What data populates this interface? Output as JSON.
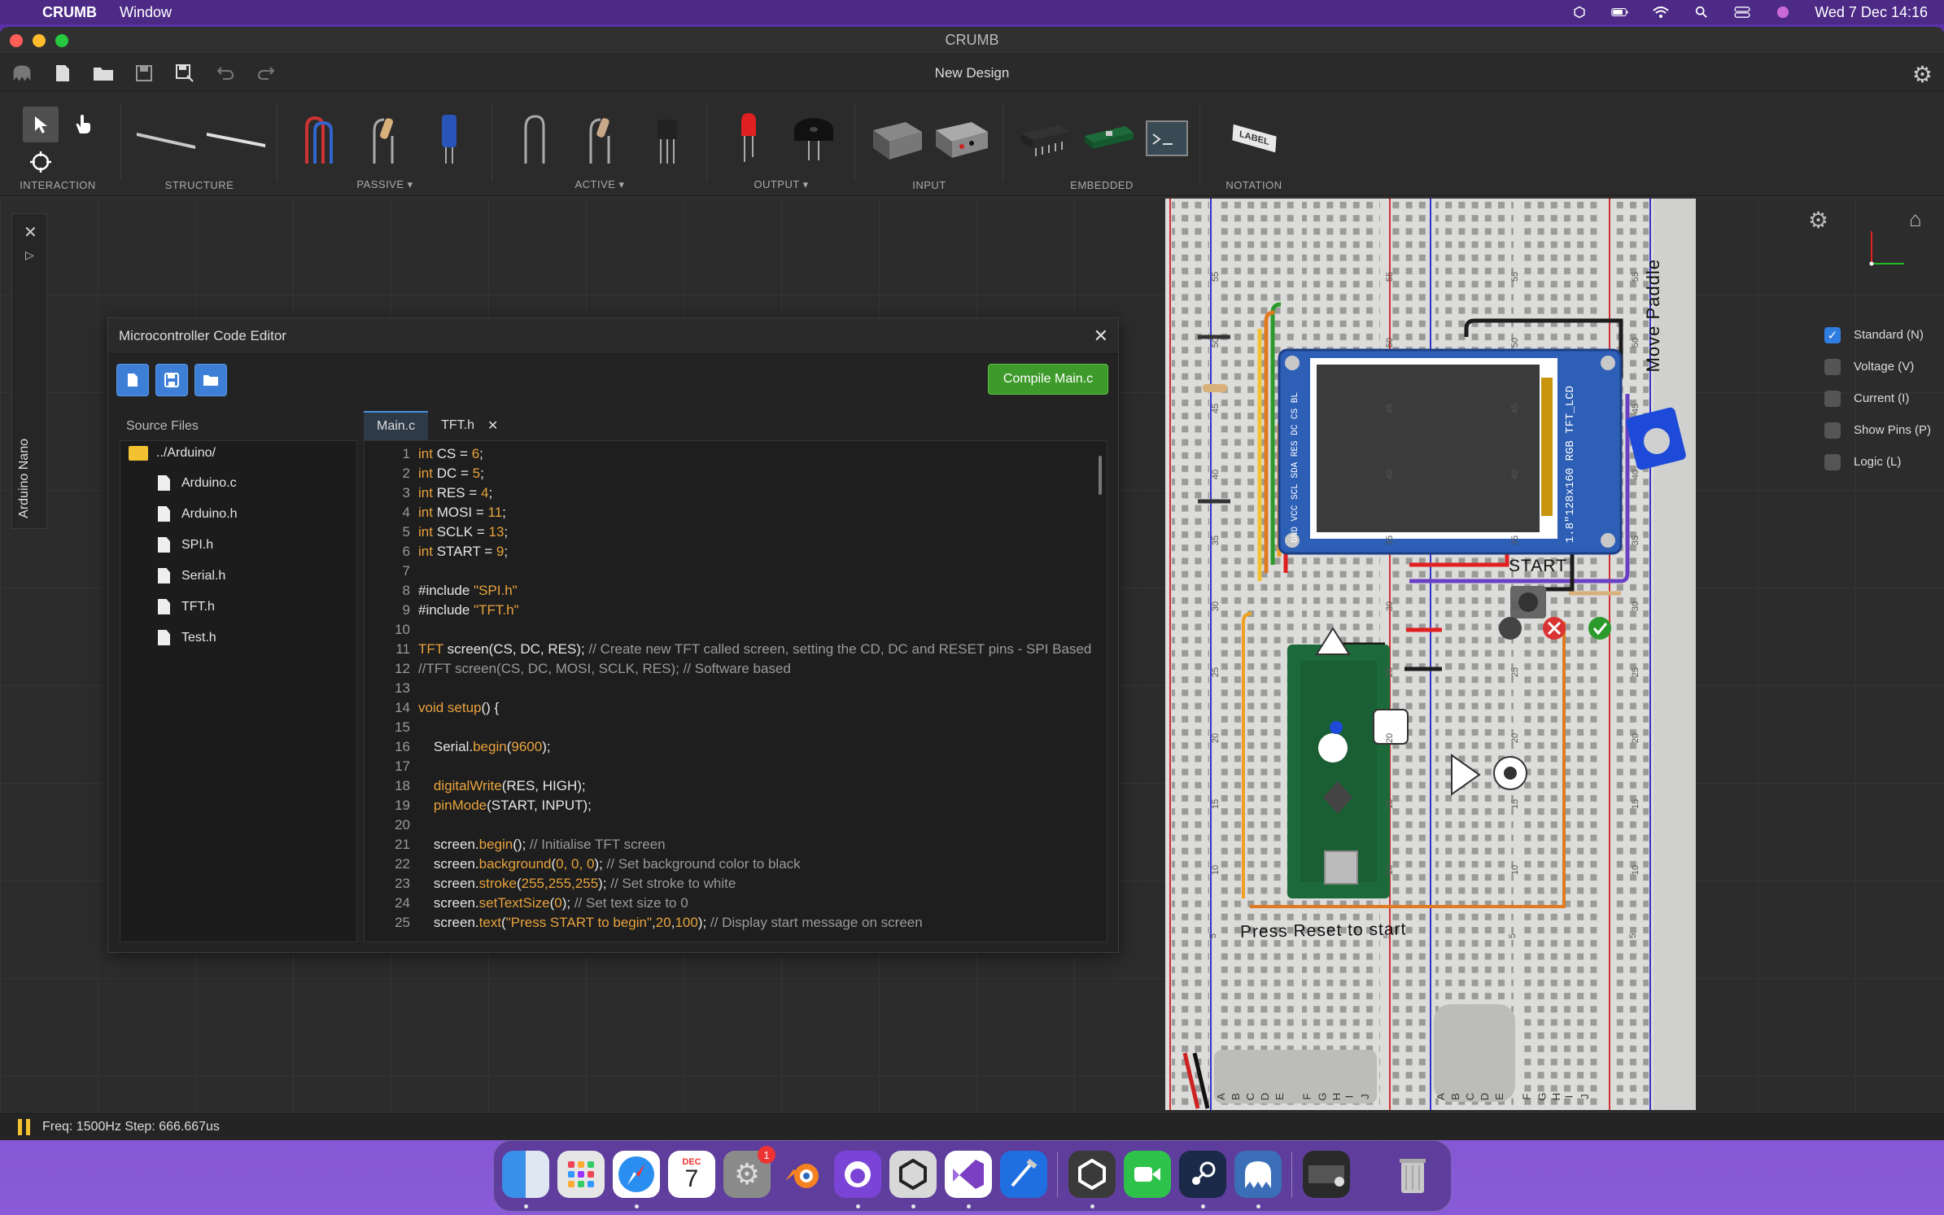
{
  "menubar": {
    "app_name": "CRUMB",
    "menu_window": "Window",
    "clock": "Wed 7 Dec  14:16"
  },
  "window": {
    "title": "CRUMB",
    "document_title": "New Design"
  },
  "toolbar": {
    "groups": [
      {
        "label": "INTERACTION"
      },
      {
        "label": "STRUCTURE"
      },
      {
        "label": "PASSIVE ▾"
      },
      {
        "label": "ACTIVE ▾"
      },
      {
        "label": "OUTPUT ▾"
      },
      {
        "label": "INPUT"
      },
      {
        "label": "EMBEDDED"
      },
      {
        "label": "NOTATION"
      }
    ],
    "notation_label_part": "LABEL"
  },
  "side_tab": {
    "label": "Arduino Nano"
  },
  "editor": {
    "title": "Microcontroller Code Editor",
    "compile_button": "Compile Main.c",
    "source_files_label": "Source Files",
    "folder": "../Arduino/",
    "files": [
      "Arduino.c",
      "Arduino.h",
      "SPI.h",
      "Serial.h",
      "TFT.h",
      "Test.h"
    ],
    "tabs": [
      {
        "label": "Main.c",
        "active": true
      },
      {
        "label": "TFT.h",
        "active": false
      }
    ],
    "code_lines": [
      [
        {
          "t": "kw",
          "v": "int"
        },
        {
          "t": "txt",
          "v": " CS = "
        },
        {
          "t": "num",
          "v": "6"
        },
        {
          "t": "txt",
          "v": ";"
        }
      ],
      [
        {
          "t": "kw",
          "v": "int"
        },
        {
          "t": "txt",
          "v": " DC = "
        },
        {
          "t": "num",
          "v": "5"
        },
        {
          "t": "txt",
          "v": ";"
        }
      ],
      [
        {
          "t": "kw",
          "v": "int"
        },
        {
          "t": "txt",
          "v": " RES = "
        },
        {
          "t": "num",
          "v": "4"
        },
        {
          "t": "txt",
          "v": ";"
        }
      ],
      [
        {
          "t": "kw",
          "v": "int"
        },
        {
          "t": "txt",
          "v": " MOSI = "
        },
        {
          "t": "num",
          "v": "11"
        },
        {
          "t": "txt",
          "v": ";"
        }
      ],
      [
        {
          "t": "kw",
          "v": "int"
        },
        {
          "t": "txt",
          "v": " SCLK = "
        },
        {
          "t": "num",
          "v": "13"
        },
        {
          "t": "txt",
          "v": ";"
        }
      ],
      [
        {
          "t": "kw",
          "v": "int"
        },
        {
          "t": "txt",
          "v": " START = "
        },
        {
          "t": "num",
          "v": "9"
        },
        {
          "t": "txt",
          "v": ";"
        }
      ],
      [],
      [
        {
          "t": "txt",
          "v": "#include "
        },
        {
          "t": "str",
          "v": "\"SPI.h\""
        }
      ],
      [
        {
          "t": "txt",
          "v": "#include "
        },
        {
          "t": "str",
          "v": "\"TFT.h\""
        }
      ],
      [],
      [
        {
          "t": "kw",
          "v": "TFT"
        },
        {
          "t": "txt",
          "v": " screen(CS, DC, RES); "
        },
        {
          "t": "com",
          "v": "// Create new TFT called screen, setting the CD, DC and RESET pins - SPI Based"
        }
      ],
      [
        {
          "t": "com",
          "v": "//TFT screen(CS, DC, MOSI, SCLK, RES); // Software based"
        }
      ],
      [],
      [
        {
          "t": "kw",
          "v": "void"
        },
        {
          "t": "txt",
          "v": " "
        },
        {
          "t": "fn",
          "v": "setup"
        },
        {
          "t": "txt",
          "v": "() {"
        }
      ],
      [],
      [
        {
          "t": "txt",
          "v": "    Serial."
        },
        {
          "t": "fn",
          "v": "begin"
        },
        {
          "t": "txt",
          "v": "("
        },
        {
          "t": "num",
          "v": "9600"
        },
        {
          "t": "txt",
          "v": ");"
        }
      ],
      [],
      [
        {
          "t": "txt",
          "v": "    "
        },
        {
          "t": "fn",
          "v": "digitalWrite"
        },
        {
          "t": "txt",
          "v": "(RES, HIGH);"
        }
      ],
      [
        {
          "t": "txt",
          "v": "    "
        },
        {
          "t": "fn",
          "v": "pinMode"
        },
        {
          "t": "txt",
          "v": "(START, INPUT);"
        }
      ],
      [],
      [
        {
          "t": "txt",
          "v": "    screen."
        },
        {
          "t": "fn",
          "v": "begin"
        },
        {
          "t": "txt",
          "v": "(); "
        },
        {
          "t": "com",
          "v": "// Initialise TFT screen"
        }
      ],
      [
        {
          "t": "txt",
          "v": "    screen."
        },
        {
          "t": "fn",
          "v": "background"
        },
        {
          "t": "txt",
          "v": "("
        },
        {
          "t": "num",
          "v": "0, 0, 0"
        },
        {
          "t": "txt",
          "v": "); "
        },
        {
          "t": "com",
          "v": "// Set background color to black"
        }
      ],
      [
        {
          "t": "txt",
          "v": "    screen."
        },
        {
          "t": "fn",
          "v": "stroke"
        },
        {
          "t": "txt",
          "v": "("
        },
        {
          "t": "num",
          "v": "255,255,255"
        },
        {
          "t": "txt",
          "v": "); "
        },
        {
          "t": "com",
          "v": "// Set stroke to white"
        }
      ],
      [
        {
          "t": "txt",
          "v": "    screen."
        },
        {
          "t": "fn",
          "v": "setTextSize"
        },
        {
          "t": "txt",
          "v": "("
        },
        {
          "t": "num",
          "v": "0"
        },
        {
          "t": "txt",
          "v": "); "
        },
        {
          "t": "com",
          "v": "// Set text size to 0"
        }
      ],
      [
        {
          "t": "txt",
          "v": "    screen."
        },
        {
          "t": "fn",
          "v": "text"
        },
        {
          "t": "txt",
          "v": "("
        },
        {
          "t": "str",
          "v": "\"Press START to begin\""
        },
        {
          "t": "txt",
          "v": ","
        },
        {
          "t": "num",
          "v": "20"
        },
        {
          "t": "txt",
          "v": ","
        },
        {
          "t": "num",
          "v": "100"
        },
        {
          "t": "txt",
          "v": "); "
        },
        {
          "t": "com",
          "v": "// Display start message on screen"
        }
      ]
    ]
  },
  "board": {
    "lcd_label": "1.8\"128x160 RGB TFT_LCD",
    "lcd_pins": "GND VCC SCL SDA RES DC CS BL",
    "start_label": "START",
    "move_paddle_label": "Move Paddle",
    "press_reset_label": "Press Reset to start",
    "row_numbers": [
      "55",
      "50",
      "45",
      "40",
      "35",
      "30",
      "25",
      "20",
      "15",
      "10",
      "5"
    ],
    "col_letters": [
      "A",
      "B",
      "C",
      "D",
      "E",
      "F",
      "G",
      "H",
      "I",
      "J"
    ]
  },
  "visibility_panel": {
    "items": [
      {
        "label": "Standard (N)",
        "checked": true
      },
      {
        "label": "Voltage (V)",
        "checked": false
      },
      {
        "label": "Current (I)",
        "checked": false
      },
      {
        "label": "Show Pins (P)",
        "checked": false
      },
      {
        "label": "Logic (L)",
        "checked": false
      }
    ]
  },
  "statusbar": {
    "text": "Freq: 1500Hz  Step: 666.667us"
  },
  "dock": {
    "calendar_month": "DEC",
    "calendar_day": "7",
    "settings_badge": "1",
    "apps": [
      "finder-icon",
      "launchpad-icon",
      "safari-icon",
      "calendar-icon",
      "system-settings-icon",
      "blender-icon",
      "github-desktop-icon",
      "unity-hub-icon",
      "visual-studio-icon",
      "xcode-icon",
      "unity-icon",
      "facetime-icon",
      "steam-icon",
      "crumb-icon",
      "screen-capture-icon",
      "trash-icon"
    ]
  }
}
